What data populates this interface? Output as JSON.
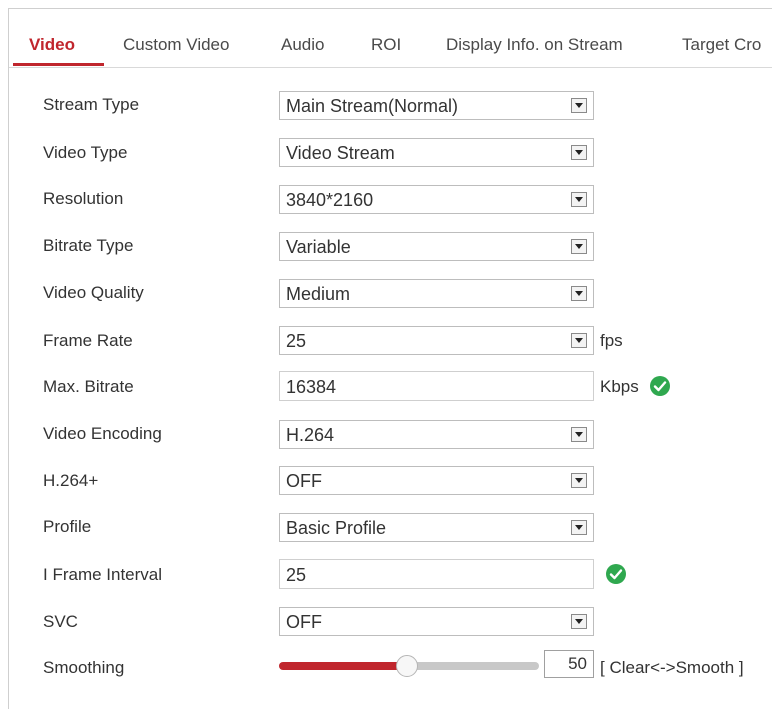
{
  "tabs": [
    {
      "label": "Video",
      "active": true
    },
    {
      "label": "Custom Video"
    },
    {
      "label": "Audio"
    },
    {
      "label": "ROI"
    },
    {
      "label": "Display Info. on Stream"
    },
    {
      "label": "Target Cro"
    }
  ],
  "form": {
    "stream_type": {
      "label": "Stream Type",
      "value": "Main Stream(Normal)"
    },
    "video_type": {
      "label": "Video Type",
      "value": "Video Stream"
    },
    "resolution": {
      "label": "Resolution",
      "value": "3840*2160"
    },
    "bitrate_type": {
      "label": "Bitrate Type",
      "value": "Variable"
    },
    "video_quality": {
      "label": "Video Quality",
      "value": "Medium"
    },
    "frame_rate": {
      "label": "Frame Rate",
      "value": "25",
      "unit": "fps"
    },
    "max_bitrate": {
      "label": "Max. Bitrate",
      "value": "16384",
      "unit": "Kbps"
    },
    "video_encoding": {
      "label": "Video Encoding",
      "value": "H.264"
    },
    "h264_plus": {
      "label": "H.264+",
      "value": "OFF"
    },
    "profile": {
      "label": "Profile",
      "value": "Basic Profile"
    },
    "i_frame_interval": {
      "label": "I Frame Interval",
      "value": "25"
    },
    "svc": {
      "label": "SVC",
      "value": "OFF"
    },
    "smoothing": {
      "label": "Smoothing",
      "value": "50",
      "fraction": 0.5,
      "range_label": "[ Clear<->Smooth ]"
    }
  },
  "colors": {
    "accent": "#c0262d",
    "check": "#2fa84f"
  }
}
